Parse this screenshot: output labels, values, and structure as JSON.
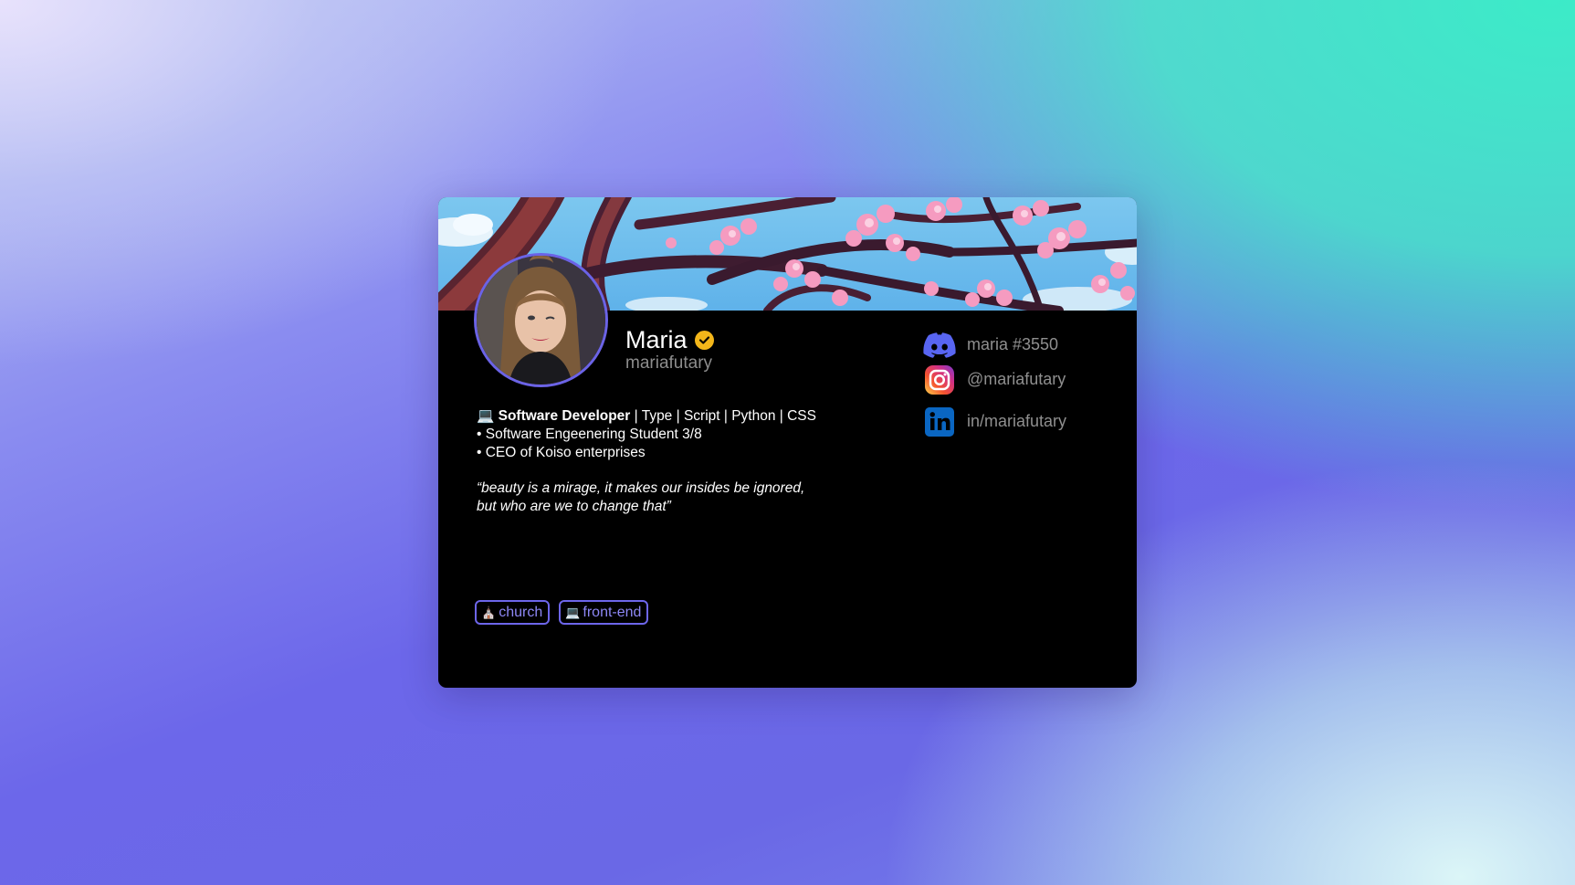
{
  "profile": {
    "display_name": "Maria",
    "username": "mariafutary",
    "verified": true
  },
  "bio": {
    "line1_icon": "laptop-icon",
    "line1_bold": "Software Developer",
    "line1_rest": " | Type | Script | Python | CSS",
    "line2": " • Software Engeenering Student 3/8",
    "line3": " • CEO of Koiso enterprises",
    "quote_line1": "“beauty is a mirage, it makes our insides be ignored,",
    "quote_line2": "but who are we to change that”"
  },
  "socials": [
    {
      "icon": "discord-icon",
      "text": "maria #3550",
      "color": "#5865f2"
    },
    {
      "icon": "instagram-icon",
      "text": "@mariafutary",
      "color": "#e1306c"
    },
    {
      "icon": "linkedin-icon",
      "text": "in/mariafutary",
      "color": "#0a66c2"
    }
  ],
  "tags": [
    {
      "icon": "church-icon",
      "label": "church"
    },
    {
      "icon": "laptop-icon",
      "label": "front-end"
    }
  ],
  "colors": {
    "accent": "#6b63e6",
    "verified": "#f3b61a",
    "card_bg": "#000000"
  }
}
